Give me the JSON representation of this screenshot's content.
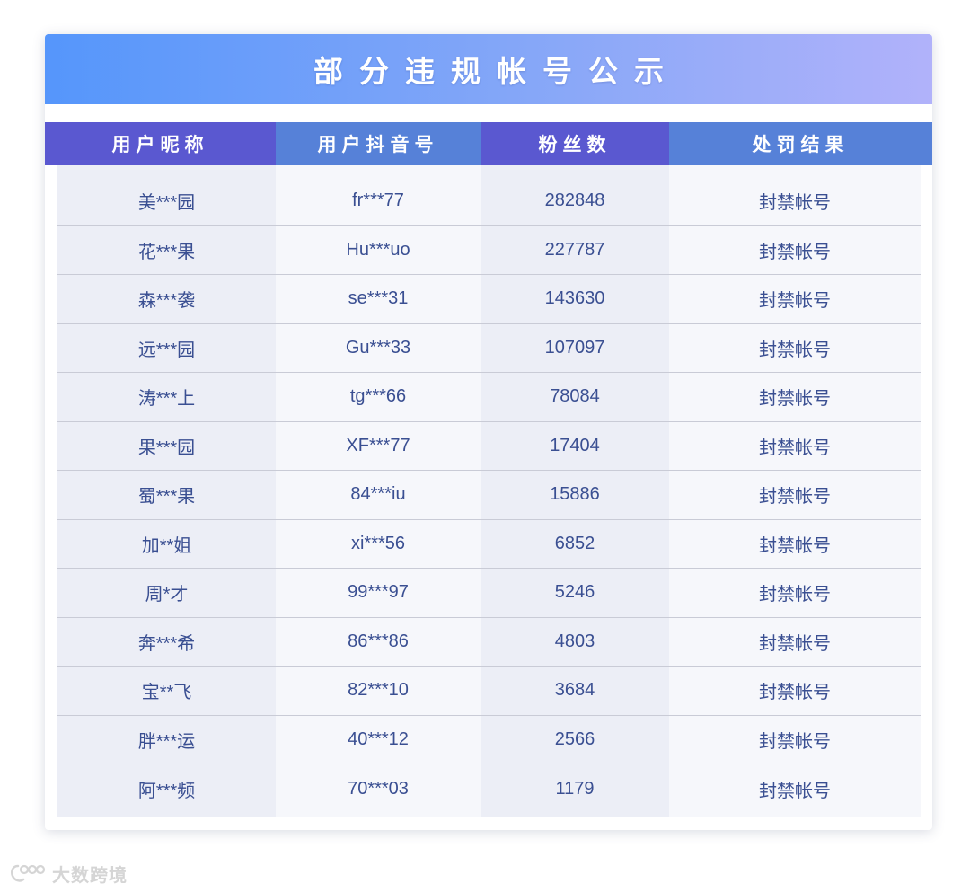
{
  "title": "部分违规帐号公示",
  "headers": [
    "用户昵称",
    "用户抖音号",
    "粉丝数",
    "处罚结果"
  ],
  "rows": [
    {
      "nickname": "美***园",
      "douyin_id": "fr***77",
      "fans": "282848",
      "result": "封禁帐号"
    },
    {
      "nickname": "花***果",
      "douyin_id": "Hu***uo",
      "fans": "227787",
      "result": "封禁帐号"
    },
    {
      "nickname": "森***袭",
      "douyin_id": "se***31",
      "fans": "143630",
      "result": "封禁帐号"
    },
    {
      "nickname": "远***园",
      "douyin_id": "Gu***33",
      "fans": "107097",
      "result": "封禁帐号"
    },
    {
      "nickname": "涛***上",
      "douyin_id": "tg***66",
      "fans": "78084",
      "result": "封禁帐号"
    },
    {
      "nickname": "果***园",
      "douyin_id": "XF***77",
      "fans": "17404",
      "result": "封禁帐号"
    },
    {
      "nickname": "蜀***果",
      "douyin_id": "84***iu",
      "fans": "15886",
      "result": "封禁帐号"
    },
    {
      "nickname": "加**姐",
      "douyin_id": "xi***56",
      "fans": "6852",
      "result": "封禁帐号"
    },
    {
      "nickname": "周*才",
      "douyin_id": "99***97",
      "fans": "5246",
      "result": "封禁帐号"
    },
    {
      "nickname": "奔***希",
      "douyin_id": "86***86",
      "fans": "4803",
      "result": "封禁帐号"
    },
    {
      "nickname": "宝**飞",
      "douyin_id": "82***10",
      "fans": "3684",
      "result": "封禁帐号"
    },
    {
      "nickname": "胖***运",
      "douyin_id": "40***12",
      "fans": "2566",
      "result": "封禁帐号"
    },
    {
      "nickname": "阿***频",
      "douyin_id": "70***03",
      "fans": "1179",
      "result": "封禁帐号"
    }
  ],
  "watermark": {
    "text": "大数跨境",
    "icon": "brand-logo-icon"
  }
}
